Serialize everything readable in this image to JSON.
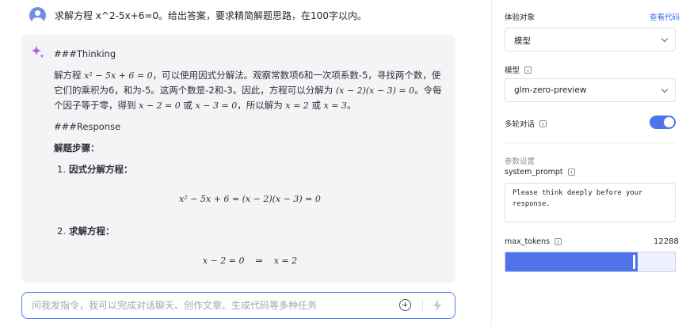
{
  "user": {
    "question": "求解方程 x^2-5x+6=0。给出答案，要求精简解题思路，在100字以内。"
  },
  "answer": {
    "thinking_heading": "###Thinking",
    "thinking_p1": "解方程 ",
    "thinking_eq1": "x² − 5x + 6 = 0",
    "thinking_p2": "，可以使用因式分解法。观察常数项6和一次项系数-5，寻找两个数，使它们的乘积为6，和为-5。这两个数是-2和-3。因此，方程可以分解为 ",
    "thinking_eq2": "(x − 2)(x − 3) = 0",
    "thinking_p3": "。令每个因子等于零，得到 ",
    "thinking_eq3": "x − 2 = 0",
    "thinking_p4": " 或 ",
    "thinking_eq4": "x − 3 = 0",
    "thinking_p5": "，所以解为 ",
    "thinking_eq5": "x = 2",
    "thinking_p6": " 或 ",
    "thinking_eq6": "x = 3",
    "thinking_p7": "。",
    "response_heading": "###Response",
    "steps_title": "解题步骤：",
    "step1_num": "1.",
    "step1_title": "因式分解方程：",
    "step1_eq": "x² − 5x + 6 = (x − 2)(x − 3) = 0",
    "step2_num": "2.",
    "step2_title": "求解方程：",
    "step2_eq_left": "x − 2 = 0",
    "step2_arrow": "⇒",
    "step2_eq_right": "x = 2"
  },
  "input": {
    "placeholder": "问我发指令，我可以完成对话聊天、创作文章、生成代码等多种任务"
  },
  "panel": {
    "target_label": "体验对象",
    "view_code_link": "查看代码",
    "target_value": "模型",
    "model_label": "模型",
    "model_value": "glm-zero-preview",
    "multi_turn_label": "多轮对话",
    "multi_turn_enabled": true,
    "params_title": "参数设置",
    "system_prompt_label": "system_prompt",
    "system_prompt_value": "Please think deeply before your response.",
    "max_tokens_label": "max_tokens",
    "max_tokens_value": "12288",
    "max_tokens_fraction": 0.78
  },
  "colors": {
    "accent": "#4f73e8",
    "link": "#3b6cf5",
    "answer_bg": "#f4f4f6"
  },
  "icons": {
    "avatar": "user-avatar-icon",
    "ai": "sparkle-icon",
    "add": "plus-circle-icon",
    "send": "lightning-icon",
    "dropdown": "chevron-down-icon",
    "info": "info-icon"
  }
}
